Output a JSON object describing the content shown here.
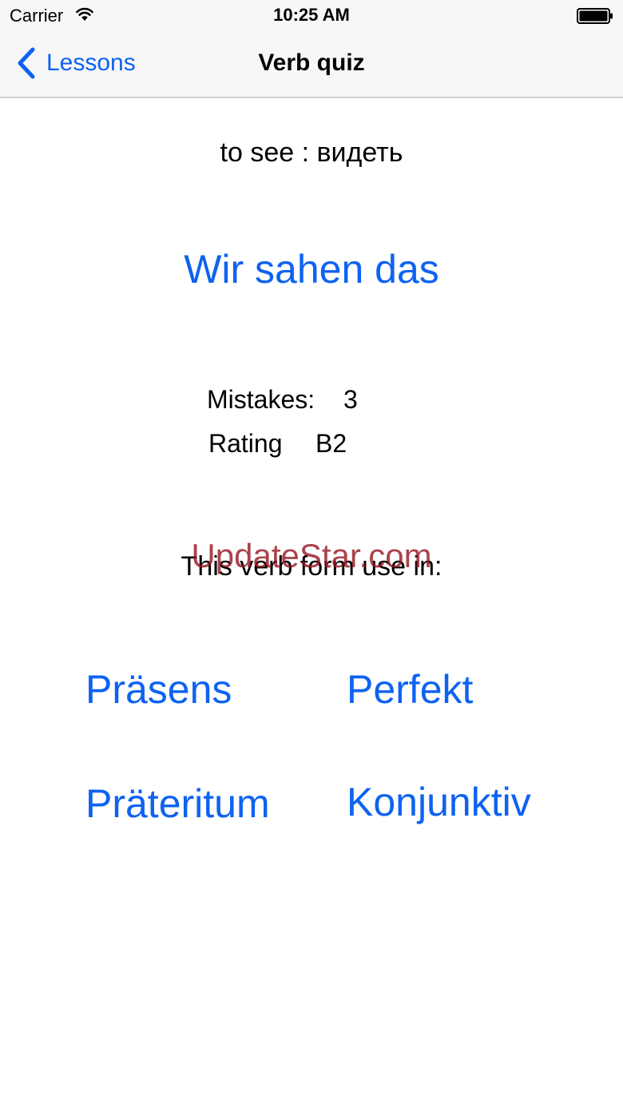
{
  "status_bar": {
    "carrier": "Carrier",
    "time": "10:25 AM",
    "wifi_icon": "wifi-icon",
    "battery_icon": "battery-icon"
  },
  "nav": {
    "back_label": "Lessons",
    "back_icon": "chevron-left-icon",
    "title": "Verb quiz"
  },
  "quiz": {
    "translation": "to see : видеть",
    "sentence": "Wir sahen das",
    "mistakes_label": "Mistakes:",
    "mistakes_value": "3",
    "rating_label": "Rating",
    "rating_value": "B2",
    "usage_prompt": "This verb form use in:",
    "watermark": "UpdateStar.com",
    "answers": [
      "Präsens",
      "Perfekt",
      "Präteritum",
      "Konjunktiv"
    ]
  },
  "colors": {
    "accent": "#0d62f2",
    "bar_background": "#f7f7f7",
    "watermark": "#96141e"
  }
}
